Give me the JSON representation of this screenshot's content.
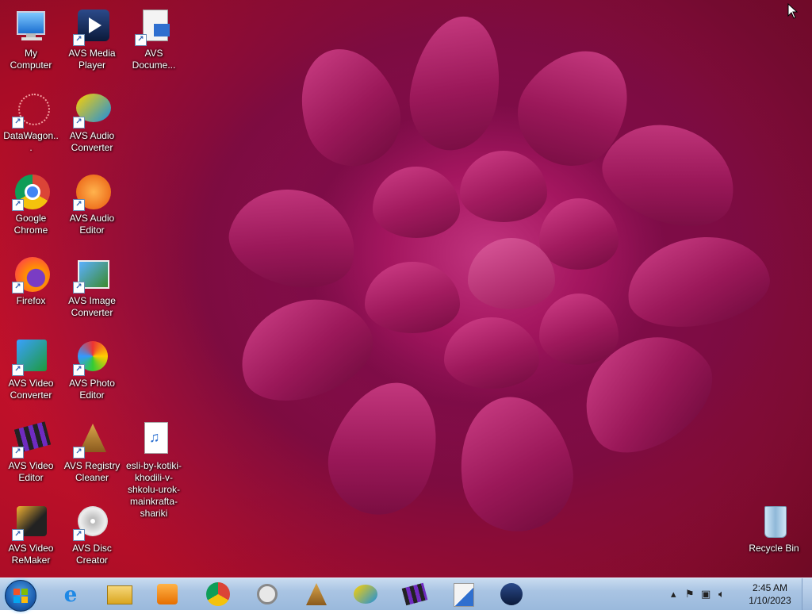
{
  "desktop_icons": [
    {
      "label": "My Computer",
      "icon": "computer-icon"
    },
    {
      "label": "AVS Media Player",
      "icon": "media-player-icon"
    },
    {
      "label": "AVS Docume...",
      "icon": "document-converter-icon"
    },
    {
      "label": "DataWagon...",
      "icon": "datawagon-icon"
    },
    {
      "label": "AVS Audio Converter",
      "icon": "audio-converter-icon"
    },
    {
      "label": "Google Chrome",
      "icon": "chrome-icon"
    },
    {
      "label": "AVS Audio Editor",
      "icon": "audio-editor-icon"
    },
    {
      "label": "Firefox",
      "icon": "firefox-icon"
    },
    {
      "label": "AVS Image Converter",
      "icon": "image-converter-icon"
    },
    {
      "label": "AVS Video Converter",
      "icon": "video-converter-icon"
    },
    {
      "label": "AVS Photo Editor",
      "icon": "photo-editor-icon"
    },
    {
      "label": "AVS Video Editor",
      "icon": "video-editor-icon"
    },
    {
      "label": "AVS Registry Cleaner",
      "icon": "registry-cleaner-icon"
    },
    {
      "label": "esli-by-kotiki-khodili-v-shkolu-urok-mainkrafta-shariki",
      "icon": "audio-file-icon"
    },
    {
      "label": "AVS Video ReMaker",
      "icon": "video-remaker-icon"
    },
    {
      "label": "AVS Disc Creator",
      "icon": "disc-creator-icon"
    },
    {
      "label": "Recycle Bin",
      "icon": "recycle-bin-icon"
    }
  ],
  "taskbar": {
    "pinned": [
      "internet-explorer-icon",
      "file-explorer-icon",
      "media-player-icon",
      "chrome-icon",
      "search-tool-icon",
      "cleaner-icon",
      "audio-converter-icon",
      "video-editor-icon",
      "document-converter-icon",
      "avs-media-player-icon"
    ],
    "clock_time": "2:45 AM",
    "clock_date": "1/10/2023"
  }
}
